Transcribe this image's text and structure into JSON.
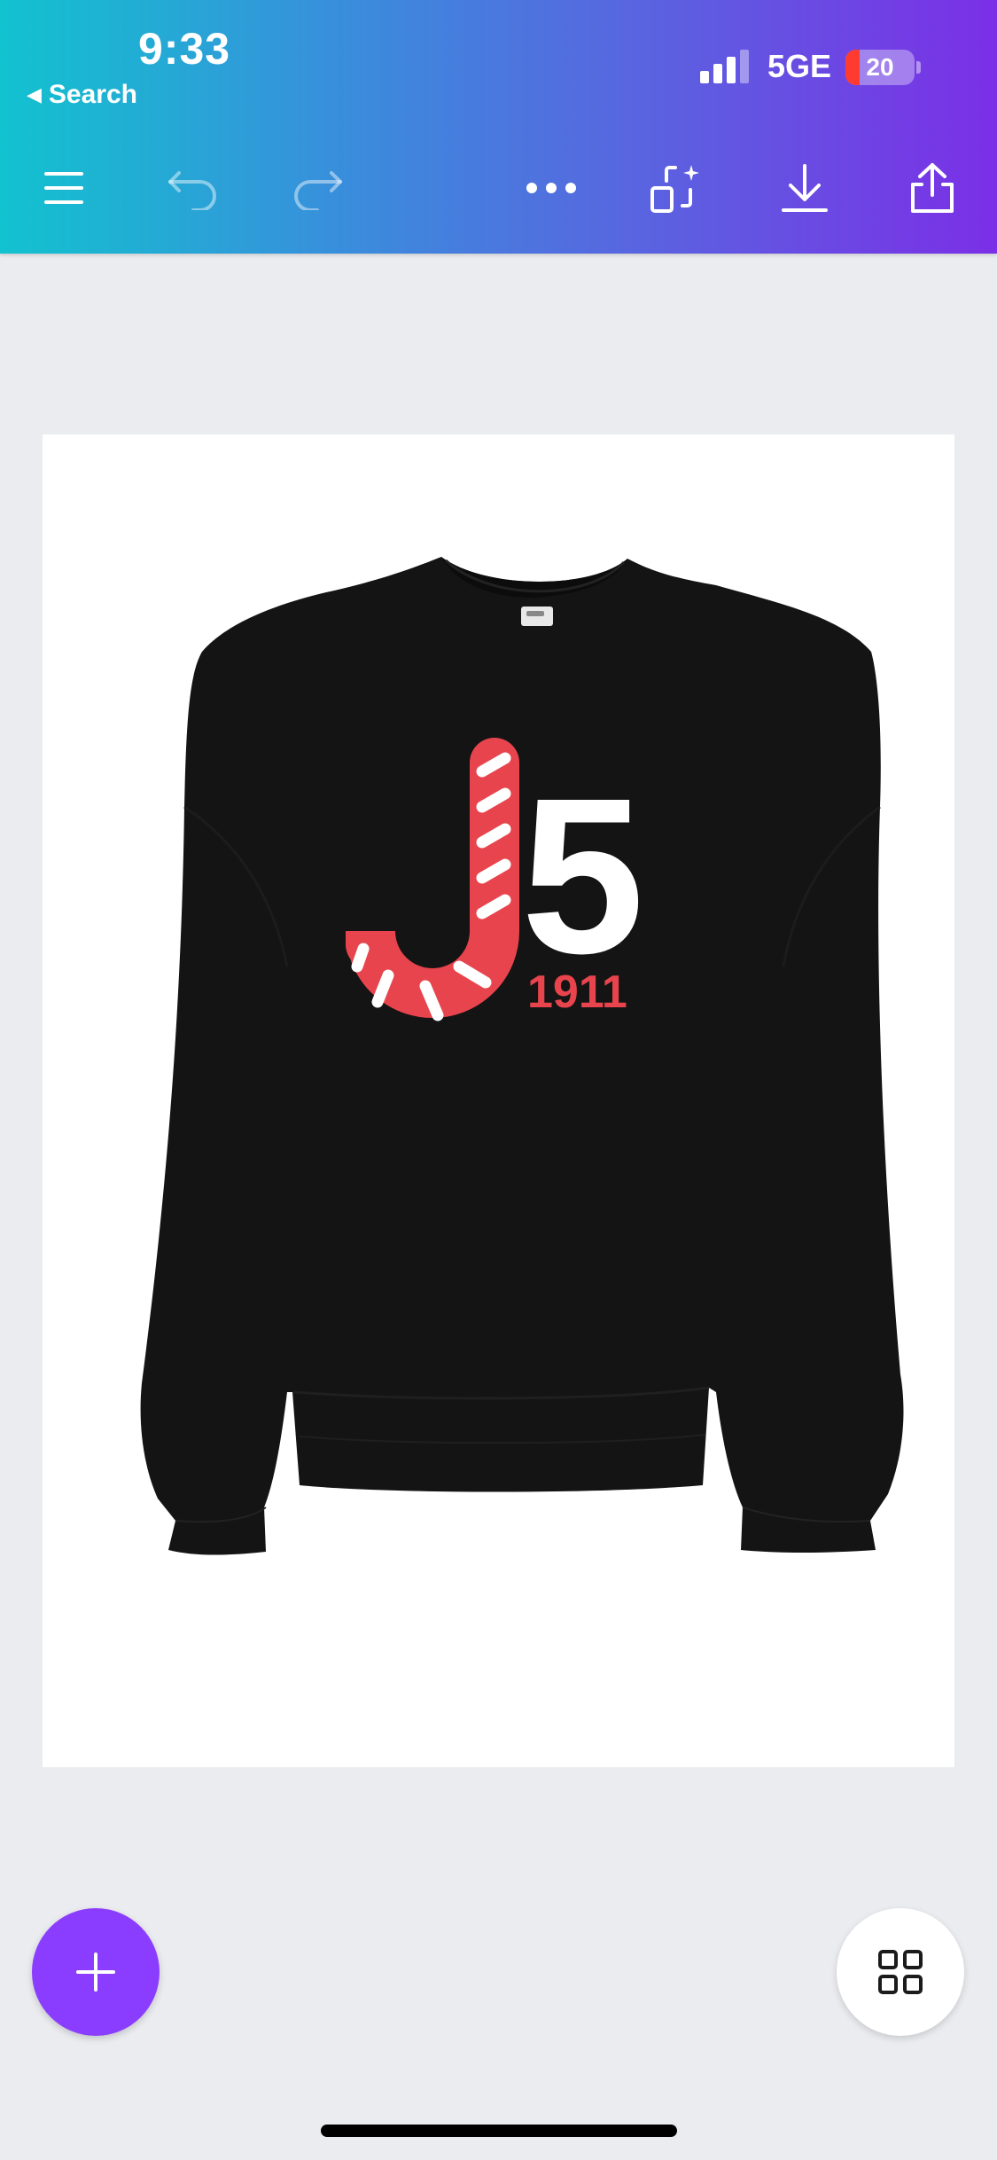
{
  "status_bar": {
    "time": "9:33",
    "back_label": "Search",
    "network": "5GE",
    "battery": "20"
  },
  "toolbar": {
    "icons": [
      "menu-icon",
      "undo-icon",
      "redo-icon",
      "more-icon",
      "magic-resize-icon",
      "download-icon",
      "share-icon"
    ]
  },
  "design": {
    "logo_year": "1911",
    "logo_number": "5",
    "colors": {
      "sweater": "#121212",
      "candy_red": "#e8444d",
      "white": "#ffffff"
    }
  },
  "bottom": {
    "add_icon": "plus-icon",
    "pages_icon": "grid-icon"
  },
  "colors": {
    "gradient_start": "#12c2cf",
    "gradient_end": "#7b2fe6",
    "accent_purple": "#8b3dff",
    "background": "#ebecf0"
  }
}
